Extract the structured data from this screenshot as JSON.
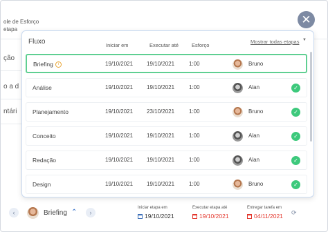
{
  "background": {
    "line1": "ole de Esforço",
    "line2": "etapa",
    "rows": [
      "ção",
      "o a d",
      "ntári"
    ]
  },
  "modal": {
    "title": "Fluxo",
    "columns": {
      "start": "Iniciar em",
      "execute": "Executar até",
      "effort": "Esforço"
    },
    "show_all_link": "Mostrar todas etapas",
    "rows": [
      {
        "name": "Briefing",
        "start": "19/10/2021",
        "execute": "19/10/2021",
        "effort": "1:00",
        "user": "Bruno",
        "status": "info"
      },
      {
        "name": "Análise",
        "start": "19/10/2021",
        "execute": "19/10/2021",
        "effort": "1:00",
        "user": "Alan",
        "status": "done"
      },
      {
        "name": "Planejamento",
        "start": "19/10/2021",
        "execute": "23/10/2021",
        "effort": "1:00",
        "user": "Bruno",
        "status": "done"
      },
      {
        "name": "Conceito",
        "start": "19/10/2021",
        "execute": "19/10/2021",
        "effort": "1:00",
        "user": "Alan",
        "status": "done"
      },
      {
        "name": "Redação",
        "start": "19/10/2021",
        "execute": "19/10/2021",
        "effort": "1:00",
        "user": "Alan",
        "status": "done"
      },
      {
        "name": "Design",
        "start": "19/10/2021",
        "execute": "19/10/2021",
        "effort": "1:00",
        "user": "Bruno",
        "status": "done"
      }
    ]
  },
  "footer": {
    "current_stage": "Briefing",
    "start_label": "Iniciar etapa em",
    "start_date": "19/10/2021",
    "execute_label": "Executar etapa até",
    "execute_date": "19/10/2021",
    "deliver_label": "Entregar tarefa em",
    "deliver_date": "04/11/2021"
  },
  "colors": {
    "accent_green": "#3dc97c",
    "selected_border": "#5fcf92",
    "overdue_red": "#e3362c",
    "close_button": "#7d8aa3"
  },
  "icons": {
    "close": "close-icon",
    "info": "info-icon",
    "check": "check-circle-icon",
    "prev": "chevron-left-icon",
    "next": "chevron-right-icon",
    "expand": "chevron-up-icon",
    "calendar": "calendar-icon",
    "refresh": "refresh-icon"
  }
}
